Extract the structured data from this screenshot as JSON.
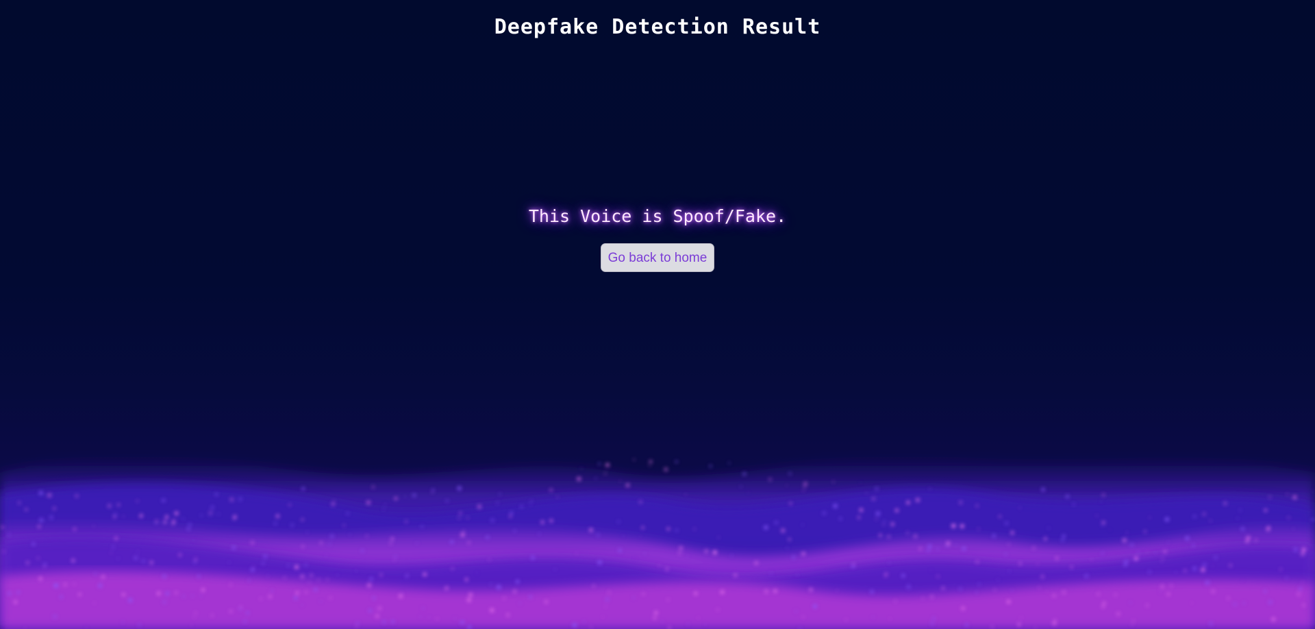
{
  "header": {
    "title": "Deepfake Detection Result"
  },
  "result": {
    "message": "This Voice is Spoof/Fake."
  },
  "actions": {
    "home_label": "Go back to home"
  },
  "colors": {
    "background": "#010a2e",
    "title_text": "#ffffff",
    "result_text": "#ffe9ff",
    "result_glow": "#a040ff",
    "button_bg": "#dcdce2",
    "button_text": "#7b3cd6",
    "wave_pink": "#e050e0",
    "wave_purple": "#6020d0"
  }
}
